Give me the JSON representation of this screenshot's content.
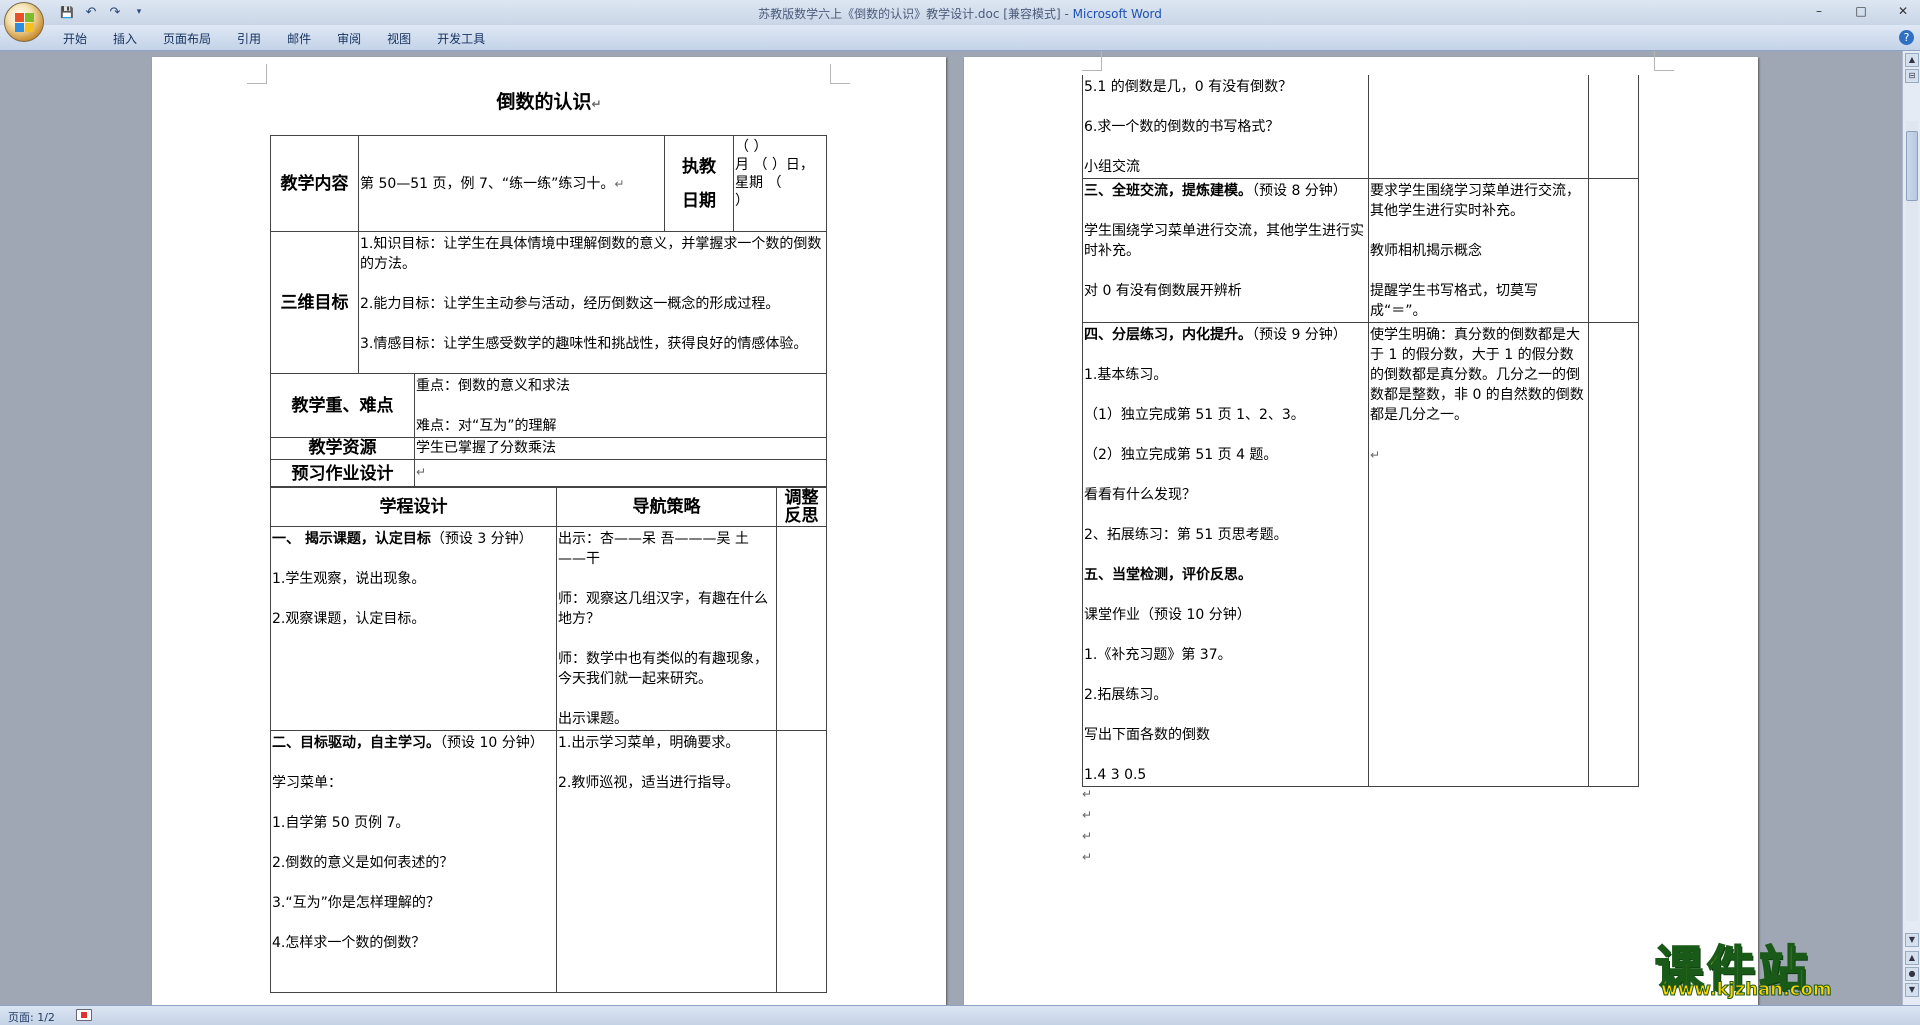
{
  "window": {
    "title_doc": "苏教版数学六上《倒数的认识》教学设计.doc [兼容模式]",
    "title_sep": " - ",
    "title_app": "Microsoft Word",
    "min_glyph": "–",
    "max_glyph": "□",
    "close_glyph": "✕"
  },
  "ribbon": {
    "tabs": [
      "开始",
      "插入",
      "页面布局",
      "引用",
      "邮件",
      "审阅",
      "视图",
      "开发工具"
    ],
    "help": "?"
  },
  "qat": {
    "save": "💾",
    "undo": "↶",
    "redo": "↷",
    "more": "▾"
  },
  "status": {
    "page": "页面: 1/2"
  },
  "mark": "↵",
  "page1": {
    "title": "倒数的认识",
    "table1": {
      "content_label": "教学内容",
      "content_text": "第 50—51 页，例 7、“练一练”练习十。",
      "date_label1": "执教",
      "date_label2": "日期",
      "date_value": [
        "（ ）",
        "月 （ ）日，",
        "星期 （",
        "）"
      ],
      "goals_label": "三维目标",
      "goals": [
        "1.知识目标：让学生在具体情境中理解倒数的意义，并掌握求一个数的倒数的方法。",
        "2.能力目标：让学生主动参与活动，经历倒数这一概念的形成过程。",
        "3.情感目标：让学生感受数学的趣味性和挑战性，获得良好的情感体验。"
      ],
      "key_label": "教学重、难点",
      "key_points": [
        "重点：倒数的意义和求法",
        "难点：对“互为”的理解"
      ],
      "resource_label": "教学资源",
      "resource_text": "学生已掌握了分数乘法",
      "homework_label": "预习作业设计"
    },
    "table2": {
      "headers": [
        "学程设计",
        "导航策略",
        "调整反思"
      ],
      "row1_col1_head": "一、 揭示课题，认定目标",
      "row1_col1_head_note": "（预设 3 分钟）",
      "row1_col1": [
        "1.学生观察，说出现象。",
        "2.观察课题，认定目标。"
      ],
      "row1_col2": [
        "出示：杏——呆 吾———吴 土——干",
        "师：观察这几组汉字，有趣在什么地方？",
        "师：数学中也有类似的有趣现象，今天我们就一起来研究。",
        "出示课题。"
      ],
      "row2_col1_head": "二、目标驱动，自主学习。",
      "row2_col1_head_note": "（预设 10 分钟）",
      "row2_col1": [
        "学习菜单：",
        "1.自学第 50 页例 7。",
        "2.倒数的意义是如何表述的？",
        "3.“互为”你是怎样理解的？",
        "4.怎样求一个数的倒数？"
      ],
      "row2_col2": [
        "1.出示学习菜单，明确要求。",
        "2.教师巡视，适当进行指导。"
      ]
    }
  },
  "page2": {
    "row0_col1": [
      "5.1 的倒数是几，0 有没有倒数？",
      "6.求一个数的倒数的书写格式？",
      "小组交流"
    ],
    "row1_col1_head": "三、全班交流，提炼建模。",
    "row1_col1_head_note": "（预设 8 分钟）",
    "row1_col1": [
      "学生围绕学习菜单进行交流，其他学生进行实时补充。",
      "对 0 有没有倒数展开辨析"
    ],
    "row1_col2": [
      "要求学生围绕学习菜单进行交流，其他学生进行实时补充。",
      "教师相机揭示概念",
      "提醒学生书写格式，切莫写成“＝”。"
    ],
    "row2_col1_head": "四、分层练习，内化提升。",
    "row2_col1_head_note": "（预设 9 分钟）",
    "row2_col1": [
      "1.基本练习。",
      "（1）独立完成第 51 页 1、2、3。",
      "（2）独立完成第 51 页 4 题。",
      "看看有什么发现？",
      "2、拓展练习：第 51 页思考题。"
    ],
    "row2_col1_head2": "五、当堂检测，评价反思。",
    "row2_col1_b": [
      "课堂作业（预设 10 分钟）",
      "1.《补充习题》第 37。",
      "2.拓展练习。",
      "写出下面各数的倒数",
      "1.4 3 0.5"
    ],
    "row2_col2": [
      "使学生明确：真分数的倒数都是大于 1 的假分数，大于 1 的假分数的倒数都是真分数。几分之一的倒数都是整数，非 0 的自然数的倒数都是几分之一。"
    ]
  },
  "watermark": {
    "cn": "课件站",
    "url": "www.kjzhan.com"
  }
}
